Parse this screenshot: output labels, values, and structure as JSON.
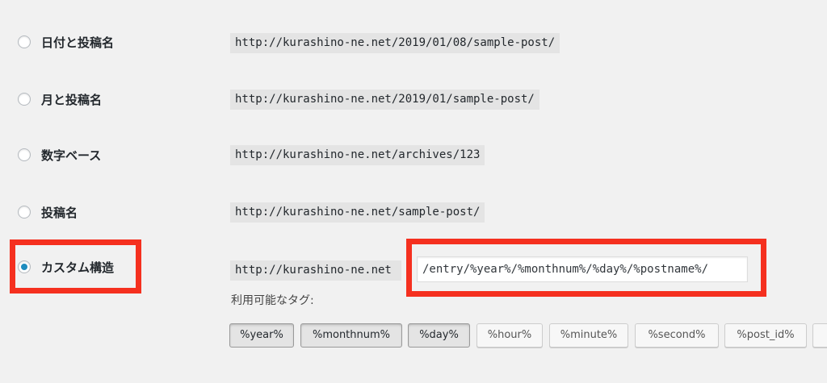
{
  "permalink_options": [
    {
      "label": "日付と投稿名",
      "example": "http://kurashino-ne.net/2019/01/08/sample-post/",
      "checked": false
    },
    {
      "label": "月と投稿名",
      "example": "http://kurashino-ne.net/2019/01/sample-post/",
      "checked": false
    },
    {
      "label": "数字ベース",
      "example": "http://kurashino-ne.net/archives/123",
      "checked": false
    },
    {
      "label": "投稿名",
      "example": "http://kurashino-ne.net/sample-post/",
      "checked": false
    }
  ],
  "custom": {
    "label": "カスタム構造",
    "base_url": "http://kurashino-ne.net",
    "structure_value": "/entry/%year%/%monthnum%/%day%/%postname%/",
    "checked": true
  },
  "available_tags_label": "利用可能なタグ:",
  "tags": [
    {
      "label": "%year%",
      "active": true
    },
    {
      "label": "%monthnum%",
      "active": true
    },
    {
      "label": "%day%",
      "active": true
    },
    {
      "label": "%hour%",
      "active": false
    },
    {
      "label": "%minute%",
      "active": false
    },
    {
      "label": "%second%",
      "active": false
    },
    {
      "label": "%post_id%",
      "active": false
    }
  ],
  "colors": {
    "highlight_red": "#f5301f",
    "radio_checked": "#1e8cbe"
  }
}
